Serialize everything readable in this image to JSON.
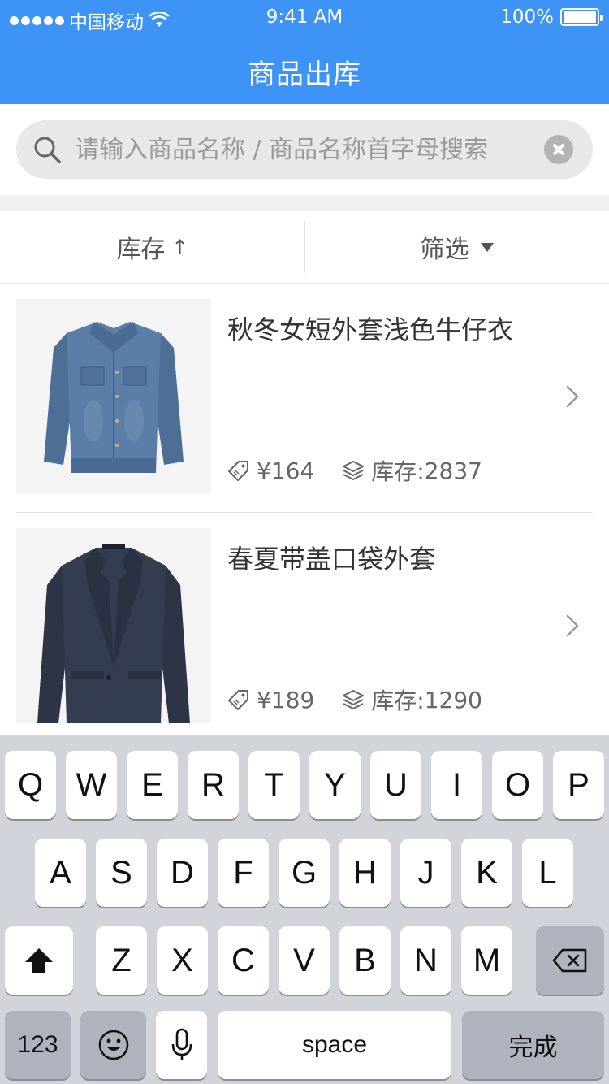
{
  "status_bar": {
    "carrier": "中国移动",
    "time": "9:41 AM",
    "battery": "100%"
  },
  "header": {
    "title": "商品出库"
  },
  "search": {
    "placeholder": "请输入商品名称 / 商品名称首字母搜索",
    "value": ""
  },
  "sort_bar": {
    "stock_label": "库存",
    "stock_arrow": "↑",
    "filter_label": "筛选"
  },
  "products": [
    {
      "name": "秋冬女短外套浅色牛仔衣",
      "price": "¥164",
      "stock_label": "库存:",
      "stock_value": "2837",
      "image": "denim-jacket"
    },
    {
      "name": "春夏带盖口袋外套",
      "price": "¥189",
      "stock_label": "库存:",
      "stock_value": "1290",
      "image": "navy-blazer"
    }
  ],
  "keyboard": {
    "row1": [
      "Q",
      "W",
      "E",
      "R",
      "T",
      "Y",
      "U",
      "I",
      "O",
      "P"
    ],
    "row2": [
      "A",
      "S",
      "D",
      "F",
      "G",
      "H",
      "J",
      "K",
      "L"
    ],
    "row3": [
      "Z",
      "X",
      "C",
      "V",
      "B",
      "N",
      "M"
    ],
    "numbers": "123",
    "space": "space",
    "done": "完成"
  },
  "colors": {
    "header": "#3d94f6",
    "keyboard_bg": "#d1d5db"
  }
}
